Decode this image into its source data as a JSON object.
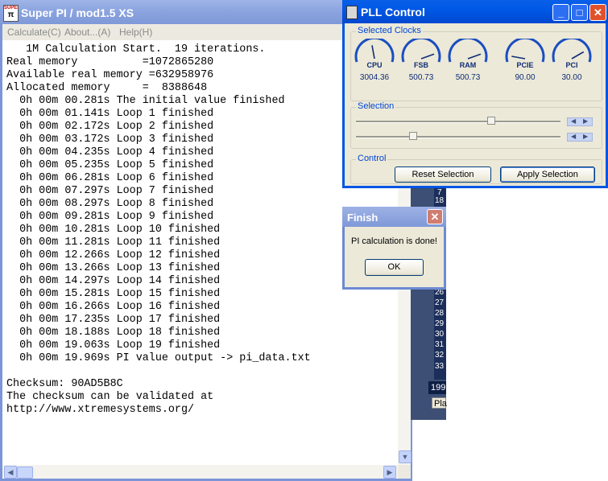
{
  "superpi": {
    "title": "Super PI / mod1.5 XS",
    "icon_text": "SUPER",
    "menu": [
      "Calculate(C)",
      "About...(A)",
      "Help(H)"
    ],
    "lines": [
      "   1M Calculation Start.  19 iterations.",
      "Real memory          =1072865280",
      "Available real memory =632958976",
      "Allocated memory     =  8388648",
      "  0h 00m 00.281s The initial value finished",
      "  0h 00m 01.141s Loop 1 finished",
      "  0h 00m 02.172s Loop 2 finished",
      "  0h 00m 03.172s Loop 3 finished",
      "  0h 00m 04.235s Loop 4 finished",
      "  0h 00m 05.235s Loop 5 finished",
      "  0h 00m 06.281s Loop 6 finished",
      "  0h 00m 07.297s Loop 7 finished",
      "  0h 00m 08.297s Loop 8 finished",
      "  0h 00m 09.281s Loop 9 finished",
      "  0h 00m 10.281s Loop 10 finished",
      "  0h 00m 11.281s Loop 11 finished",
      "  0h 00m 12.266s Loop 12 finished",
      "  0h 00m 13.266s Loop 13 finished",
      "  0h 00m 14.297s Loop 14 finished",
      "  0h 00m 15.281s Loop 15 finished",
      "  0h 00m 16.266s Loop 16 finished",
      "  0h 00m 17.235s Loop 17 finished",
      "  0h 00m 18.188s Loop 18 finished",
      "  0h 00m 19.063s Loop 19 finished",
      "  0h 00m 19.969s PI value output -> pi_data.txt",
      "",
      "Checksum: 90AD5B8C",
      "The checksum can be validated at",
      "http://www.xtremesystems.org/"
    ]
  },
  "pll": {
    "title": "PLL Control",
    "selected_clocks_label": "Selected Clocks",
    "clocks": [
      {
        "name": "CPU",
        "value": "3004.36",
        "needle_deg": -10
      },
      {
        "name": "FSB",
        "value": "500.73",
        "needle_deg": 70
      },
      {
        "name": "RAM",
        "value": "500.73",
        "needle_deg": 70
      },
      {
        "name": "PCIE",
        "value": "90.00",
        "needle_deg": -80
      },
      {
        "name": "PCI",
        "value": "30.00",
        "needle_deg": 60
      }
    ],
    "selection_label": "Selection",
    "sliders": [
      0.66,
      0.28
    ],
    "control_label": "Control",
    "reset_label": "Reset Selection",
    "apply_label": "Apply Selection"
  },
  "finish": {
    "title": "Finish",
    "message": "PI calculation is done!",
    "ok_label": "OK"
  },
  "background_app": {
    "numbers": [
      "7",
      "18",
      "26",
      "27",
      "28",
      "29",
      "30",
      "31",
      "32",
      "33"
    ],
    "box_text": "199",
    "button_text": "Pla"
  },
  "colors": {
    "xp_blue": "#0055e5",
    "inactive_title": "#7f99d8",
    "dialog_face": "#ece9d8",
    "gauge_blue": "#1a4ec0"
  }
}
